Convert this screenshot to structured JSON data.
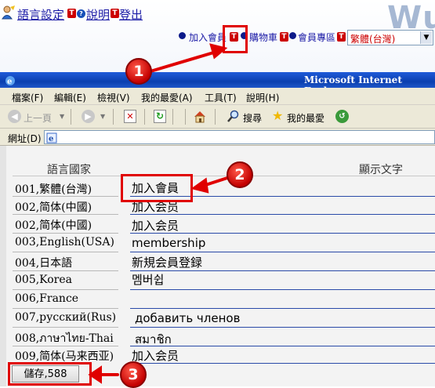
{
  "topbar": {
    "language_label": "語言設定",
    "help_label": "說明",
    "logout_label": "登出",
    "t_badge": "T",
    "logo_text": "Wu",
    "links": [
      "加入會員",
      "購物車",
      "會員專區"
    ],
    "language_select_value": "繁體(台灣)"
  },
  "browser": {
    "title": "Microsoft Internet Explorer",
    "menu": [
      "檔案(F)",
      "編輯(E)",
      "檢視(V)",
      "我的最愛(A)",
      "工具(T)",
      "說明(H)"
    ],
    "back_label": "上一頁",
    "search_label": "搜尋",
    "favorites_label": "我的最愛",
    "address_label": "網址(D)"
  },
  "table": {
    "header_language": "語言國家",
    "header_display": "顯示文字",
    "rows": [
      {
        "lang": "001,繁體(台灣)",
        "text": "加入會員"
      },
      {
        "lang": "002,简体(中國)",
        "text": "加入会员"
      },
      {
        "lang": "002,简体(中國)",
        "text": "加入会员"
      },
      {
        "lang": "003,English(USA)",
        "text": "membership"
      },
      {
        "lang": "004,日本語",
        "text": "新規会員登録"
      },
      {
        "lang": "005,Korea",
        "text": "멤버쉽"
      },
      {
        "lang": "006,France",
        "text": ""
      },
      {
        "lang": "007,русский(Rus)",
        "text": "добавить членов"
      },
      {
        "lang": "008,ภาษาไทย-Thai",
        "text": "สมาชิก"
      },
      {
        "lang": "009,简体(马来西亚)",
        "text": "加入会员"
      }
    ]
  },
  "save_button_label": "儲存,588",
  "markers": [
    "1",
    "2",
    "3"
  ],
  "colors": {
    "accent_red": "#e00000",
    "titlebar_blue": "#0a3fb0",
    "link_blue": "#1a1aa6"
  }
}
